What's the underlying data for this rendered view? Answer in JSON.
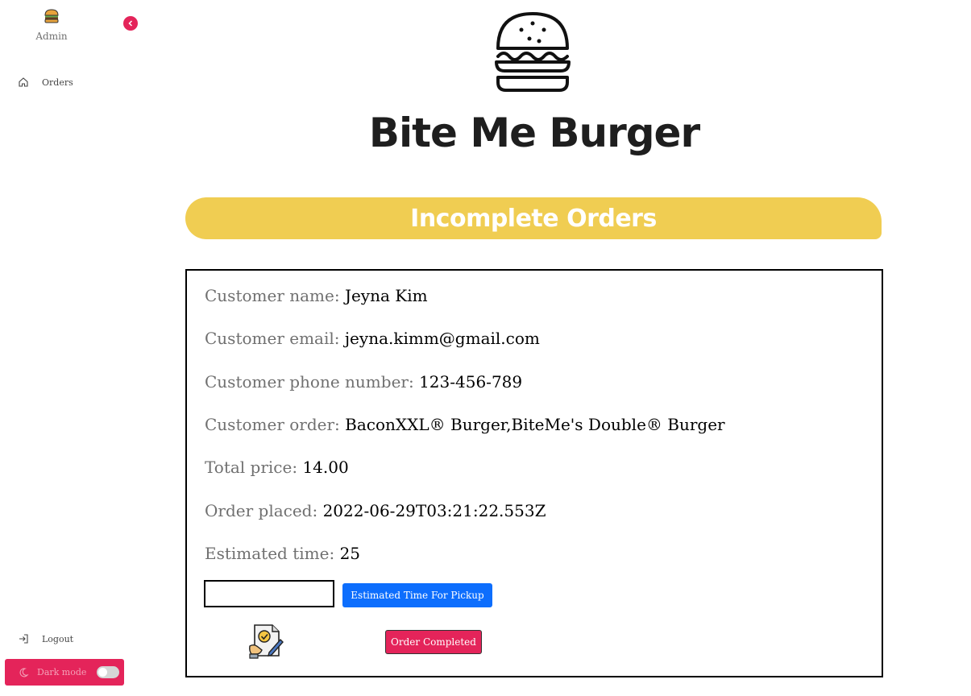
{
  "sidebar": {
    "brand_name": "Admin",
    "nav": [
      {
        "label": "Orders",
        "icon": "home-icon"
      }
    ],
    "logout_label": "Logout",
    "dark_mode_label": "Dark mode",
    "dark_mode_on": false,
    "accent_color": "#e4245a"
  },
  "header": {
    "title": "Bite Me Burger",
    "section_title": "Incomplete Orders",
    "banner_color": "#f0cd52"
  },
  "order": {
    "name_label": "Customer name:",
    "name": "Jeyna Kim",
    "email_label": "Customer email:",
    "email": "jeyna.kimm@gmail.com",
    "phone_label": "Customer phone number:",
    "phone": "123-456-789",
    "items_label": "Customer order:",
    "items": "BaconXXL® Burger,BiteMe's Double® Burger",
    "total_label": "Total price:",
    "total": "14.00",
    "placed_label": "Order placed:",
    "placed": "2022-06-29T03:21:22.553Z",
    "est_label": "Estimated time:",
    "est": "25",
    "time_input_value": "",
    "est_button_label": "Estimated Time For Pickup",
    "est_button_color": "#0d6efd",
    "complete_button_label": "Order Completed"
  }
}
